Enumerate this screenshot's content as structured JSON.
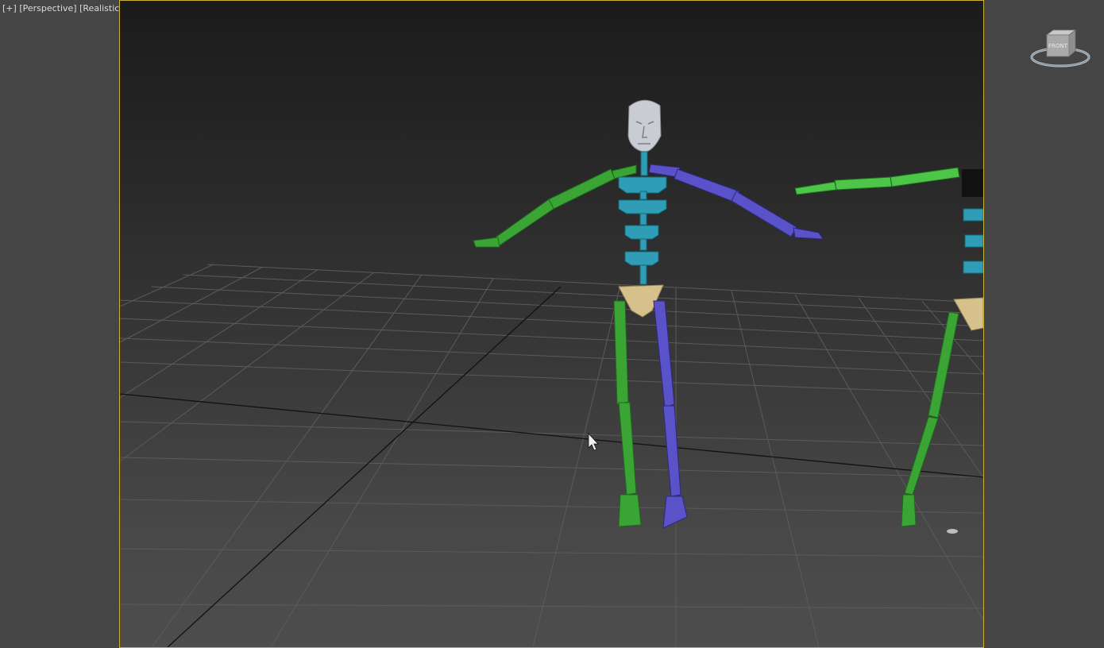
{
  "viewport": {
    "label_plus": "[+]",
    "label_view": "[Perspective]",
    "label_shading": "[Realistic]",
    "border_color": "#c9b235"
  },
  "viewcube": {
    "face_label": "FRONT",
    "icon": "viewcube-icon"
  },
  "scene": {
    "biped_colors": {
      "left_limbs": "#3aa535",
      "right_limbs": "#5a52c8",
      "spine": "#2e9db5",
      "pelvis": "#d6c08c",
      "head": "#c9ccd2"
    }
  }
}
